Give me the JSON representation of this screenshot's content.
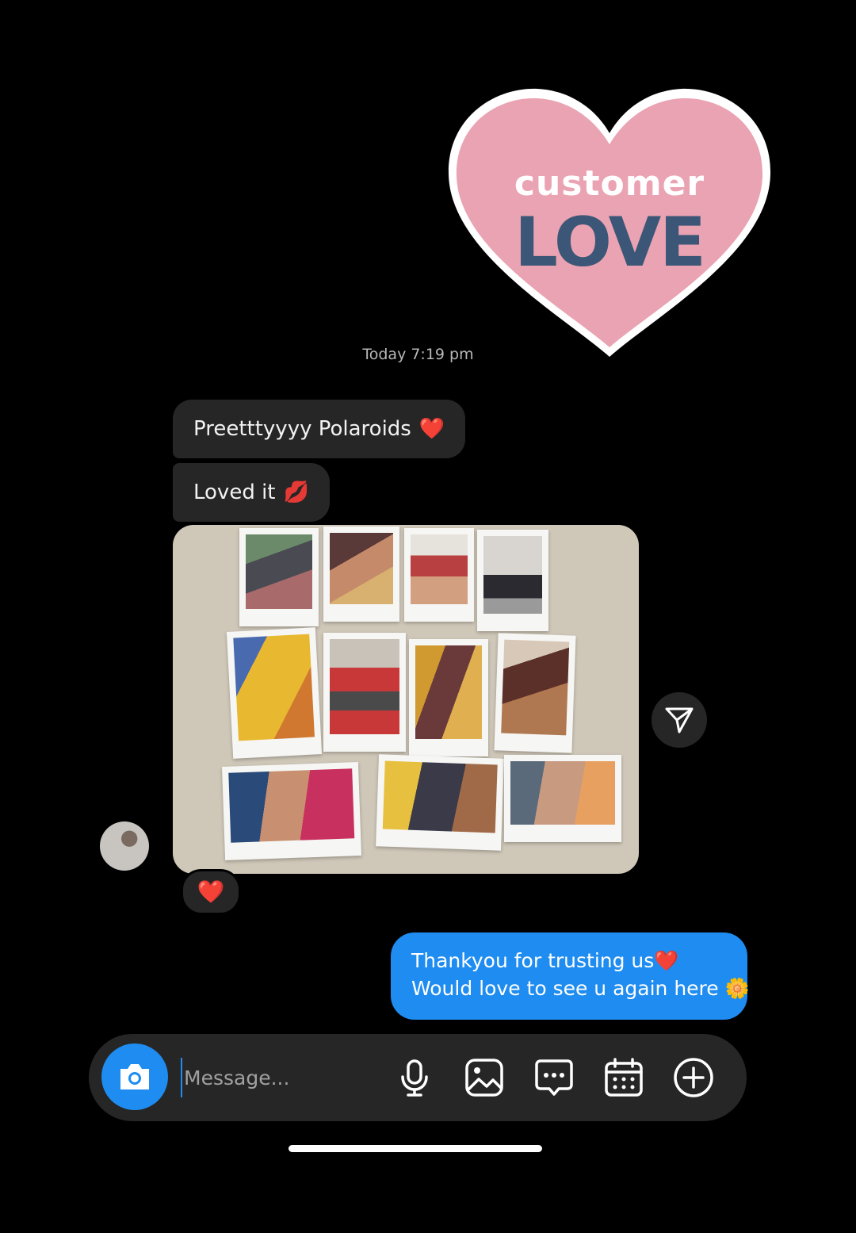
{
  "sticker": {
    "line1": "customer",
    "line2": "LOVE",
    "heart_color": "#eaa3b2",
    "border_color": "#ffffff",
    "accent_text_color": "#3b5676"
  },
  "conversation": {
    "timestamp": "Today 7:19 pm",
    "incoming": [
      {
        "text": "Preetttyyyy Polaroids",
        "emoji": "❤️"
      },
      {
        "text": "Loved it",
        "emoji": "💋"
      }
    ],
    "photo_reaction": "❤️",
    "outgoing": {
      "line1": "Thankyou for trusting us❤️",
      "line2": "Would love to see u again here 🌼"
    }
  },
  "composer": {
    "placeholder": "Message...",
    "icons": [
      "camera-icon",
      "microphone-icon",
      "gallery-icon",
      "chat-bubble-icon",
      "calendar-icon",
      "plus-circle-icon"
    ]
  },
  "colors": {
    "background": "#000000",
    "bubble_incoming": "#262626",
    "bubble_outgoing": "#1e8cf0"
  }
}
